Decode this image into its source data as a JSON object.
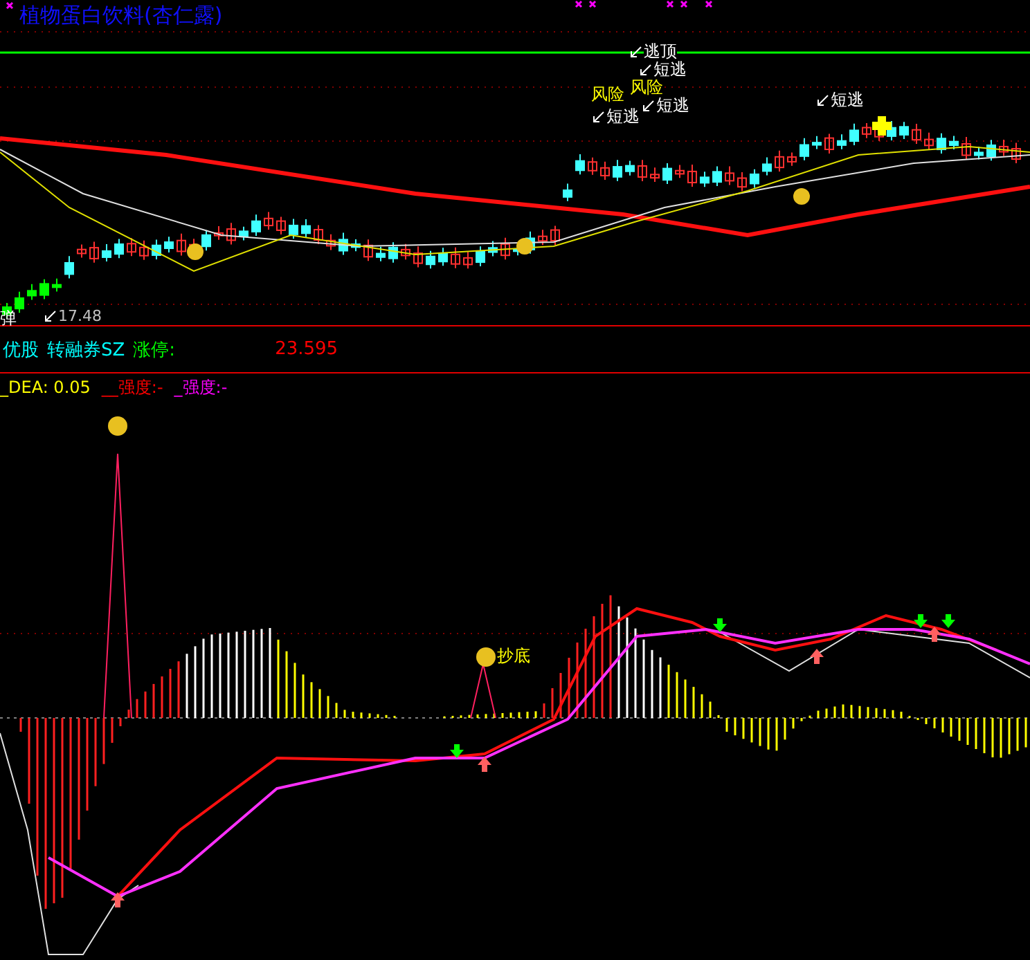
{
  "title": "植物蛋白饮料(杏仁露)",
  "signals": [
    {
      "text": "逃顶",
      "kind": "arrow"
    },
    {
      "text": "短逃",
      "kind": "arrow"
    },
    {
      "text": "风险",
      "kind": "plain"
    },
    {
      "text": "风险",
      "kind": "plain"
    },
    {
      "text": "短逃",
      "kind": "arrow"
    },
    {
      "text": "短逃",
      "kind": "arrow"
    },
    {
      "text": "短逃",
      "kind": "arrow"
    }
  ],
  "low_mark": {
    "price": "17.48",
    "label": "弹"
  },
  "info": [
    {
      "text": "优股",
      "color": "#00ffff"
    },
    {
      "text": "转融券SZ",
      "color": "#00ffff"
    },
    {
      "text": "涨停:",
      "color": "#00ff00"
    },
    {
      "text": "23.595",
      "color": "#ff0000"
    }
  ],
  "legend": [
    {
      "text": "_DEA: 0.05",
      "color": "#ffff00"
    },
    {
      "text": "__强度:-",
      "color": "#ff0000"
    },
    {
      "text": "_强度:-",
      "color": "#ff00ff"
    }
  ],
  "indicator_signal": {
    "text": "抄底"
  }
}
